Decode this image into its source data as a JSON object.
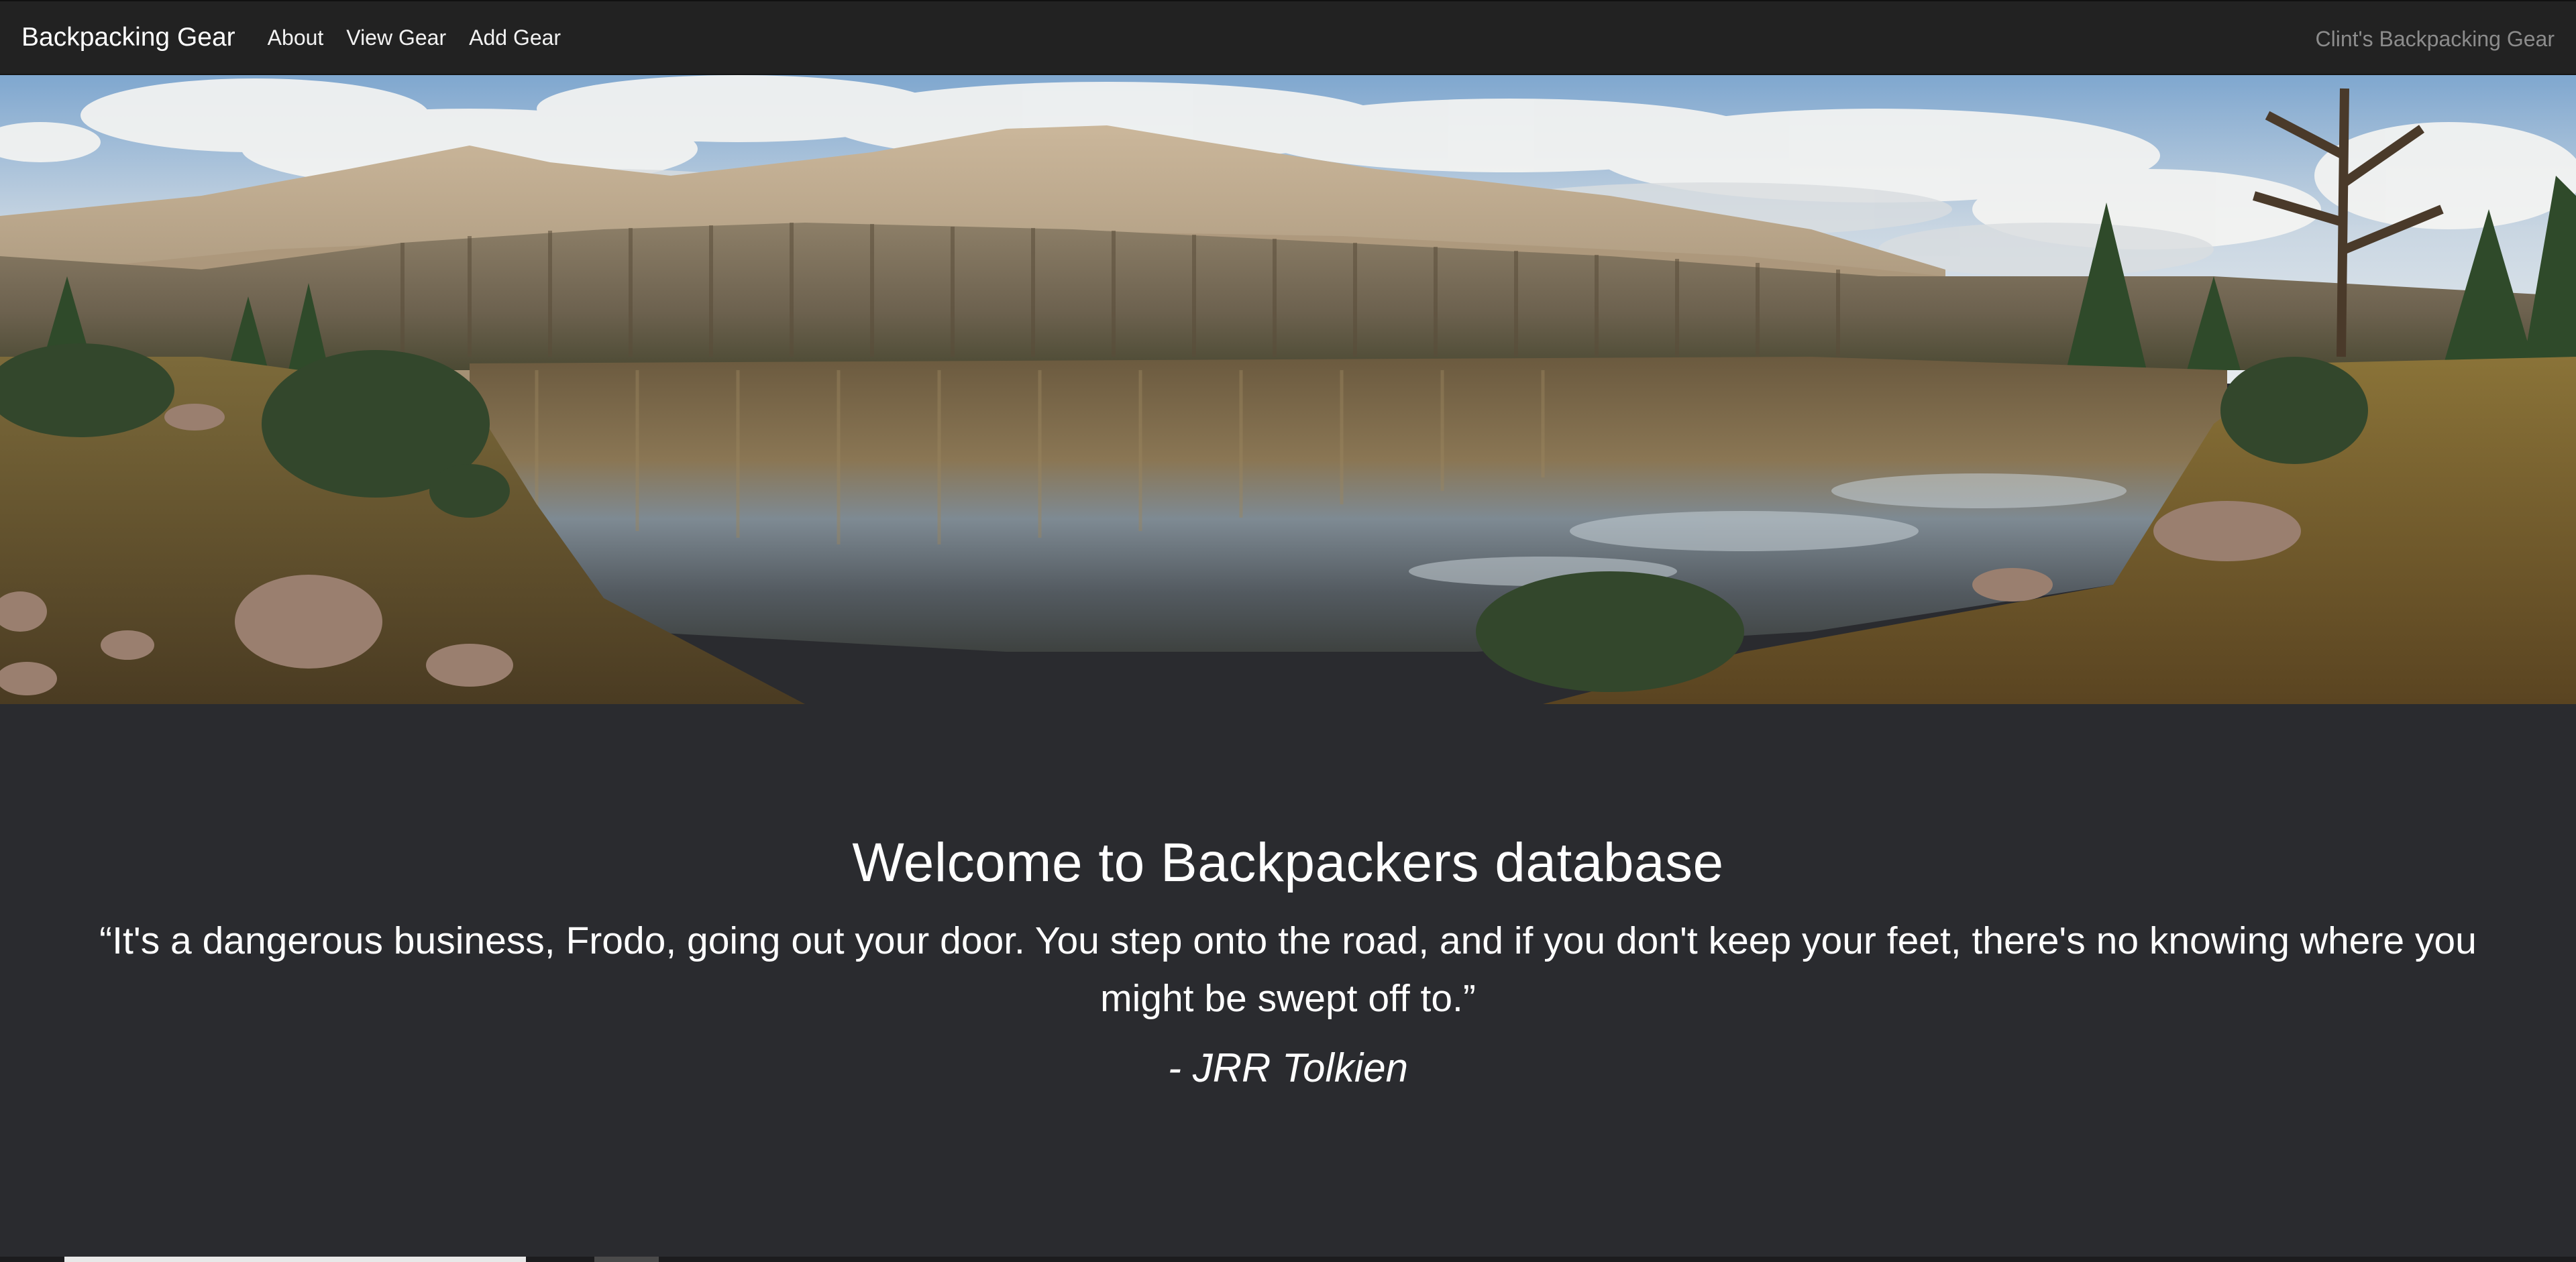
{
  "navbar": {
    "brand": "Backpacking Gear",
    "links": [
      {
        "label": "About"
      },
      {
        "label": "View Gear"
      },
      {
        "label": "Add Gear"
      }
    ],
    "right_text": "Clint's Backpacking Gear"
  },
  "hero": {
    "icon": "mountain-lake-landscape-image"
  },
  "jumbotron": {
    "title": "Welcome to Backpackers database",
    "quote": "“It's a dangerous business, Frodo, going out your door. You step onto the road, and if you don't keep your feet, there's no knowing where you might be swept off to.”",
    "author": "- JRR Tolkien"
  },
  "colors": {
    "navbar_bg": "#222222",
    "page_bg": "#2a2b2f",
    "nav_right_text": "#8c8c8c"
  }
}
